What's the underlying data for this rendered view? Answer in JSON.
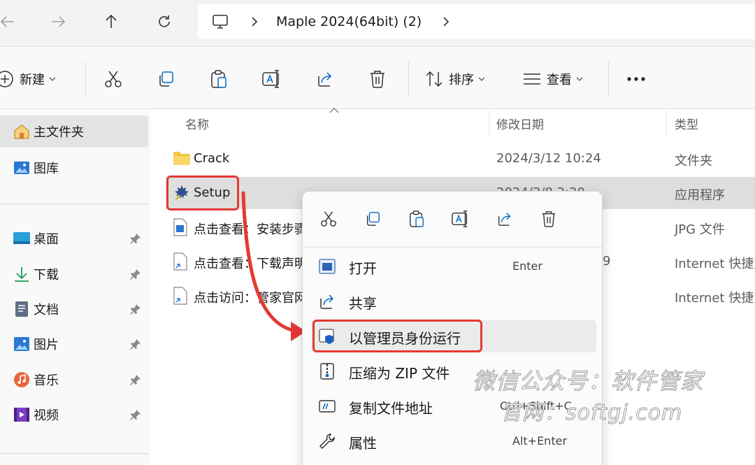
{
  "nav": {
    "breadcrumb": "Maple 2024(64bit) (2)"
  },
  "toolbar": {
    "new_label": "新建",
    "sort_label": "排序",
    "view_label": "查看"
  },
  "sidebar": {
    "items": [
      {
        "label": "主文件夹",
        "icon": "home-icon"
      },
      {
        "label": "图库",
        "icon": "gallery-icon"
      },
      {
        "label": "桌面",
        "icon": "desktop-icon"
      },
      {
        "label": "下载",
        "icon": "download-icon"
      },
      {
        "label": "文档",
        "icon": "document-icon"
      },
      {
        "label": "图片",
        "icon": "pictures-icon"
      },
      {
        "label": "音乐",
        "icon": "music-icon"
      },
      {
        "label": "视频",
        "icon": "video-icon"
      }
    ]
  },
  "columns": {
    "name": "名称",
    "modified": "修改日期",
    "type": "类型"
  },
  "files": [
    {
      "name": "Crack",
      "date": "2024/3/12 10:24",
      "type": "文件夹"
    },
    {
      "name": "Setup",
      "date": "2024/3/8 3:20",
      "type": "应用程序"
    },
    {
      "name": "点击查看：安装步骤",
      "date": "",
      "type": "JPG 文件"
    },
    {
      "name": "点击查看：下载声明",
      "date": "9",
      "type": "Internet 快捷方式"
    },
    {
      "name": "点击访问：管家官网",
      "date": "",
      "type": "Internet 快捷方式"
    }
  ],
  "context_menu": {
    "items": [
      {
        "label": "打开",
        "shortcut": "Enter"
      },
      {
        "label": "共享",
        "shortcut": ""
      },
      {
        "label": "以管理员身份运行",
        "shortcut": ""
      },
      {
        "label": "压缩为 ZIP 文件",
        "shortcut": ""
      },
      {
        "label": "复制文件地址",
        "shortcut": "Ctrl+Shift+C"
      },
      {
        "label": "属性",
        "shortcut": "Alt+Enter"
      }
    ]
  },
  "watermark": {
    "line1": "微信公众号：软件管家",
    "line2": "官网：softgj.com"
  },
  "colors": {
    "highlight": "#e53935",
    "accent": "#0067c0",
    "folder": "#f4c542"
  }
}
